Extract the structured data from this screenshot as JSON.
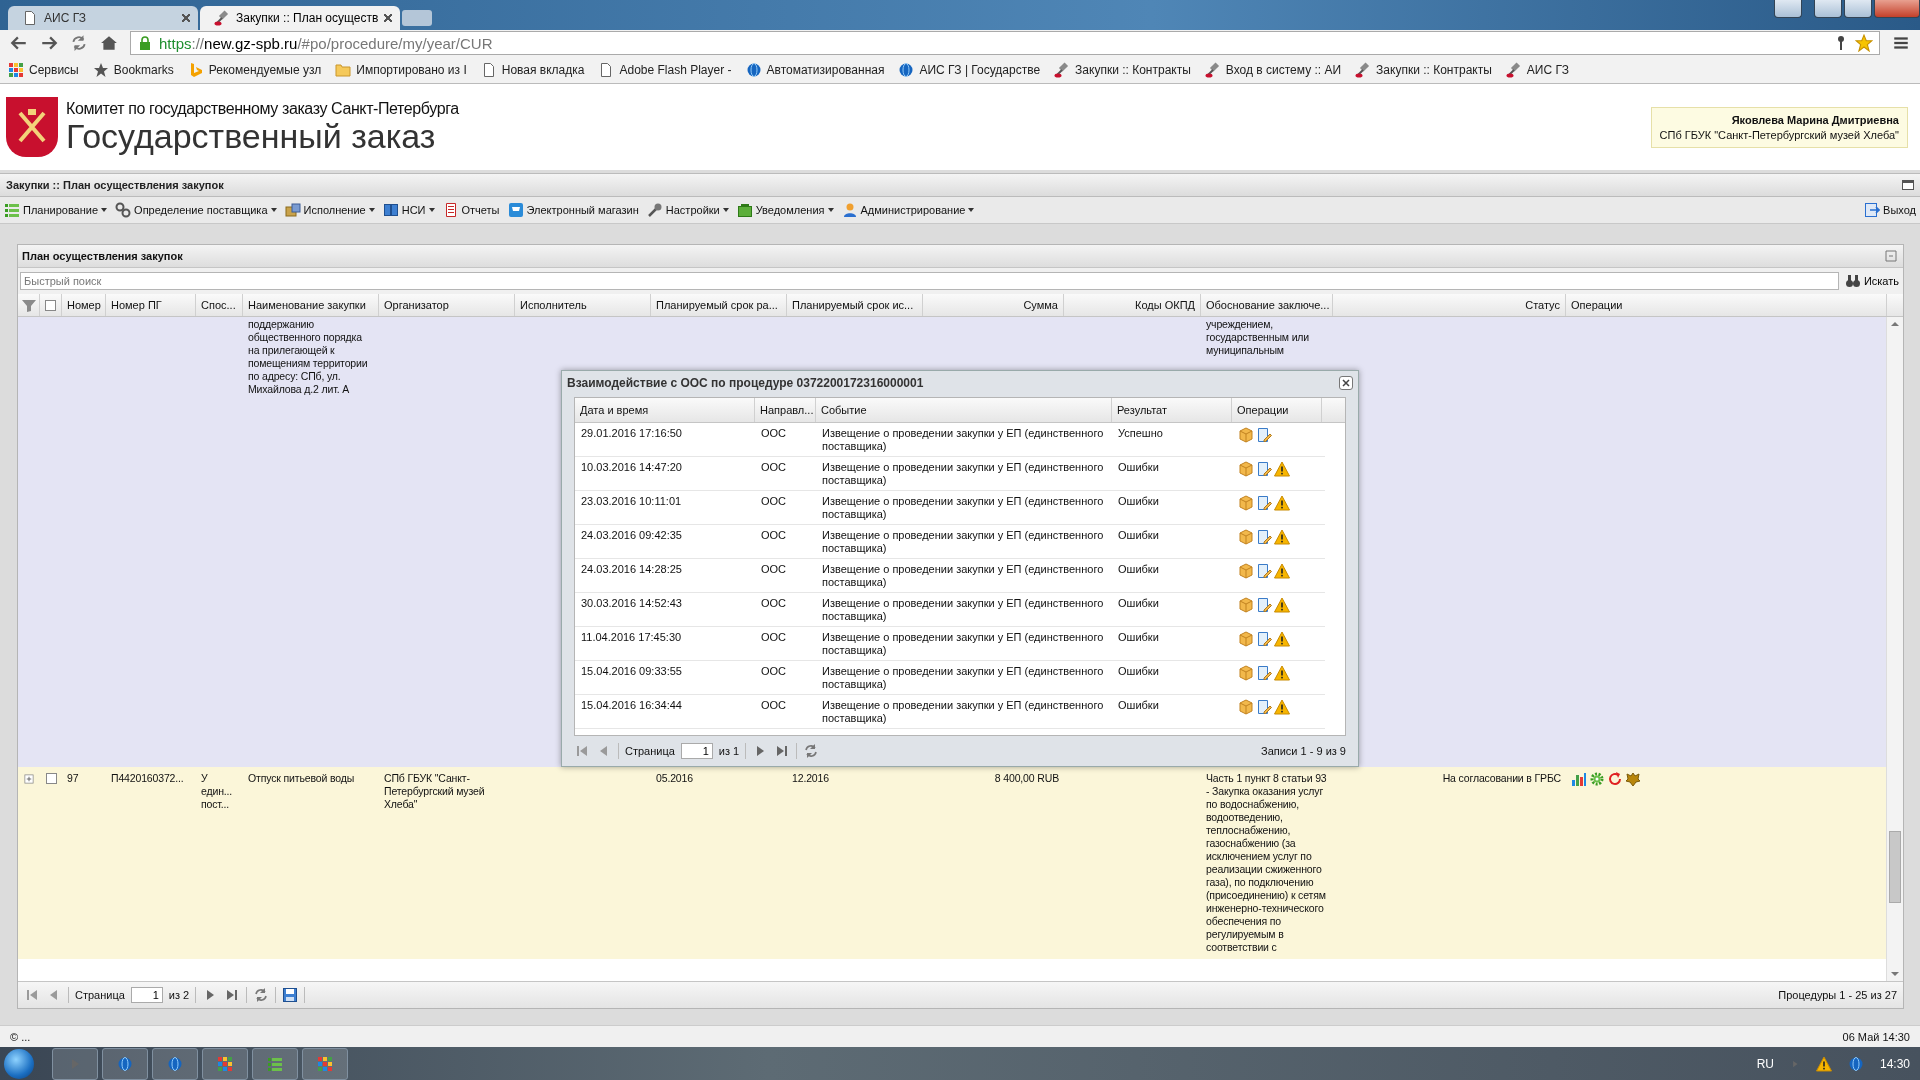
{
  "browser": {
    "tabs": [
      {
        "title": "АИС ГЗ",
        "selected": false
      },
      {
        "title": "Закупки :: План осуществ",
        "selected": true
      }
    ],
    "url": {
      "scheme": "https",
      "separator": "://",
      "host": "new.gz-spb.ru",
      "path": "/#po/procedure/my/year/CUR"
    },
    "bookmarks": [
      {
        "label": "Сервисы"
      },
      {
        "label": "Bookmarks"
      },
      {
        "label": "Рекомендуемые узл"
      },
      {
        "label": "Импортировано из I"
      },
      {
        "label": "Новая вкладка"
      },
      {
        "label": "Adobe Flash Player -"
      },
      {
        "label": "Автоматизированная"
      },
      {
        "label": "АИС ГЗ | Государстве"
      },
      {
        "label": "Закупки :: Контракты"
      },
      {
        "label": "Вход в систему :: АИ"
      },
      {
        "label": "Закупки :: Контракты"
      },
      {
        "label": "АИС ГЗ"
      }
    ]
  },
  "header": {
    "org": "Комитет по государственному заказу Санкт-Петербурга",
    "title": "Государственный заказ",
    "user": {
      "name": "Яковлева Марина Дмитриевна",
      "org": "СПб ГБУК \"Санкт-Петербургский музей Хлеба\""
    }
  },
  "page_title": "Закупки :: План осуществления закупок",
  "menu": [
    {
      "label": "Планирование",
      "dropdown": true
    },
    {
      "label": "Определение поставщика",
      "dropdown": true
    },
    {
      "label": "Исполнение",
      "dropdown": true
    },
    {
      "label": "НСИ",
      "dropdown": true
    },
    {
      "label": "Отчеты",
      "dropdown": false
    },
    {
      "label": "Электронный магазин",
      "dropdown": false
    },
    {
      "label": "Настройки",
      "dropdown": true
    },
    {
      "label": "Уведомления",
      "dropdown": true
    },
    {
      "label": "Администрирование",
      "dropdown": true
    }
  ],
  "menu_right": {
    "label": "Выход"
  },
  "grid": {
    "title": "План осуществления закупок",
    "search": {
      "placeholder": "Быстрый поиск",
      "button": "Искать"
    },
    "all_checked": false,
    "columns": [
      "Номер",
      "Номер ПГ",
      "Спос...",
      "Наименование закупки",
      "Организатор",
      "Исполнитель",
      "Планируемый срок ра...",
      "Планируемый срок ис...",
      "Сумма",
      "Коды ОКПД",
      "Обоснование заключе...",
      "Статус",
      "Операции"
    ],
    "rows": [
      {
        "kind": "partial",
        "selected": false,
        "name": "поддержанию общественного порядка на прилегающей к помещениям территории по адресу: СПб, ул. Михайлова д.2 лит. А",
        "basis": "учреждением, государственным или муниципальным"
      },
      {
        "kind": "full",
        "selected": true,
        "checked": false,
        "number": "97",
        "pg_number": "П4420160372...",
        "method": "У един... пост...",
        "name": "Отпуск питьевой воды",
        "organizer": "СПб ГБУК \"Санкт-Петербургский музей Хлеба\"",
        "start": "05.2016",
        "end": "12.2016",
        "sum": "8 400,00 RUB",
        "basis": "Часть 1 пункт 8 статьи 93 - Закупка оказания услуг по водоснабжению, водоотведению, теплоснабжению, газоснабжению (за исключением услуг по реализации сжиженного газа), по подключению (присоединению) к сетям инженерно-технического обеспечения по регулируемым в соответствии с",
        "status": "На согласовании в ГРБС"
      }
    ],
    "pager": {
      "page_label": "Страница",
      "page": "1",
      "of": "из 2",
      "summary": "Процедуры 1 - 25 из 27"
    }
  },
  "dialog": {
    "title": "Взаимодействие с ООС по процедуре 0372200172316000001",
    "columns": [
      "Дата и время",
      "Направл...",
      "Событие",
      "Результат",
      "Операции"
    ],
    "rows": [
      {
        "datetime": "29.01.2016 17:16:50",
        "direction": "ООС",
        "event": "Извещение о проведении закупки у ЕП (единственного поставщика)",
        "result": "Успешно",
        "warning": false
      },
      {
        "datetime": "10.03.2016 14:47:20",
        "direction": "ООС",
        "event": "Извещение о проведении закупки у ЕП (единственного поставщика)",
        "result": "Ошибки",
        "warning": true
      },
      {
        "datetime": "23.03.2016 10:11:01",
        "direction": "ООС",
        "event": "Извещение о проведении закупки у ЕП (единственного поставщика)",
        "result": "Ошибки",
        "warning": true
      },
      {
        "datetime": "24.03.2016 09:42:35",
        "direction": "ООС",
        "event": "Извещение о проведении закупки у ЕП (единственного поставщика)",
        "result": "Ошибки",
        "warning": true
      },
      {
        "datetime": "24.03.2016 14:28:25",
        "direction": "ООС",
        "event": "Извещение о проведении закупки у ЕП (единственного поставщика)",
        "result": "Ошибки",
        "warning": true
      },
      {
        "datetime": "30.03.2016 14:52:43",
        "direction": "ООС",
        "event": "Извещение о проведении закупки у ЕП (единственного поставщика)",
        "result": "Ошибки",
        "warning": true
      },
      {
        "datetime": "11.04.2016 17:45:30",
        "direction": "ООС",
        "event": "Извещение о проведении закупки у ЕП (единственного поставщика)",
        "result": "Ошибки",
        "warning": true
      },
      {
        "datetime": "15.04.2016 09:33:55",
        "direction": "ООС",
        "event": "Извещение о проведении закупки у ЕП (единственного поставщика)",
        "result": "Ошибки",
        "warning": true
      },
      {
        "datetime": "15.04.2016 16:34:44",
        "direction": "ООС",
        "event": "Извещение о проведении закупки у ЕП (единственного поставщика)",
        "result": "Ошибки",
        "warning": true
      }
    ],
    "pager": {
      "page_label": "Страница",
      "page": "1",
      "of": "из 1",
      "summary": "Записи 1 - 9 из 9"
    }
  },
  "status_bar": {
    "left": "© ...",
    "right": "06 Май 14:30"
  },
  "taskbar": {
    "lang": "RU",
    "time": "14:30"
  }
}
